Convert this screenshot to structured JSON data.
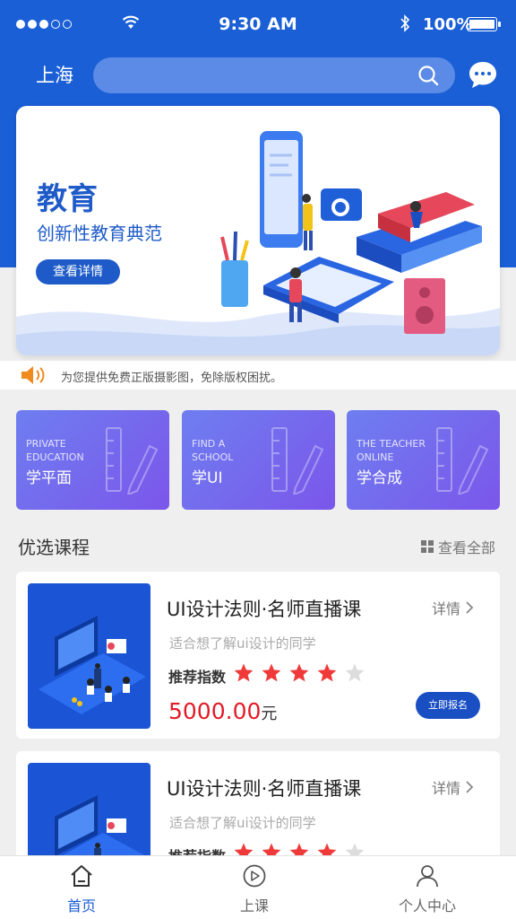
{
  "status_bar": {
    "time": "9:30 AM",
    "battery": "100%"
  },
  "header": {
    "city": "上海"
  },
  "banner": {
    "title": "教育",
    "subtitle": "创新性教育典范",
    "button": "查看详情"
  },
  "notice": {
    "text": "为您提供免费正版摄影图，免除版权困扰。"
  },
  "features": [
    {
      "en": "PRIVATE\nEDUCATION",
      "zh": "学平面"
    },
    {
      "en": "FIND A\nSCHOOL",
      "zh": "学UI"
    },
    {
      "en": "THE TEACHER\nONLINE",
      "zh": "学合成"
    }
  ],
  "section": {
    "title": "优选课程",
    "view_all": "查看全部"
  },
  "courses": [
    {
      "title": "UI设计法则·名师直播课",
      "details": "详情",
      "audience": "适合想了解ui设计的同学",
      "rating_label": "推荐指数",
      "rating": 4,
      "rating_max": 5,
      "price": "5000.00",
      "unit": "元",
      "enroll": "立即报名"
    },
    {
      "title": "UI设计法则·名师直播课",
      "details": "详情",
      "audience": "适合想了解ui设计的同学",
      "rating_label": "推荐指数",
      "rating": 4,
      "rating_max": 5
    }
  ],
  "tabbar": {
    "home": "首页",
    "class": "上课",
    "profile": "个人中心"
  },
  "colors": {
    "primary": "#1a5fd6",
    "price": "#e21b28",
    "star_on": "#f03a3a",
    "star_off": "#dddddd",
    "feature_gradient": [
      "#6e7ef0",
      "#7b56ea"
    ]
  },
  "icons": [
    "wifi-icon",
    "bluetooth-icon",
    "battery-icon",
    "search-icon",
    "message-icon",
    "speaker-icon",
    "grid-icon",
    "chevron-right-icon",
    "star-icon",
    "home-icon",
    "play-icon",
    "user-icon"
  ]
}
